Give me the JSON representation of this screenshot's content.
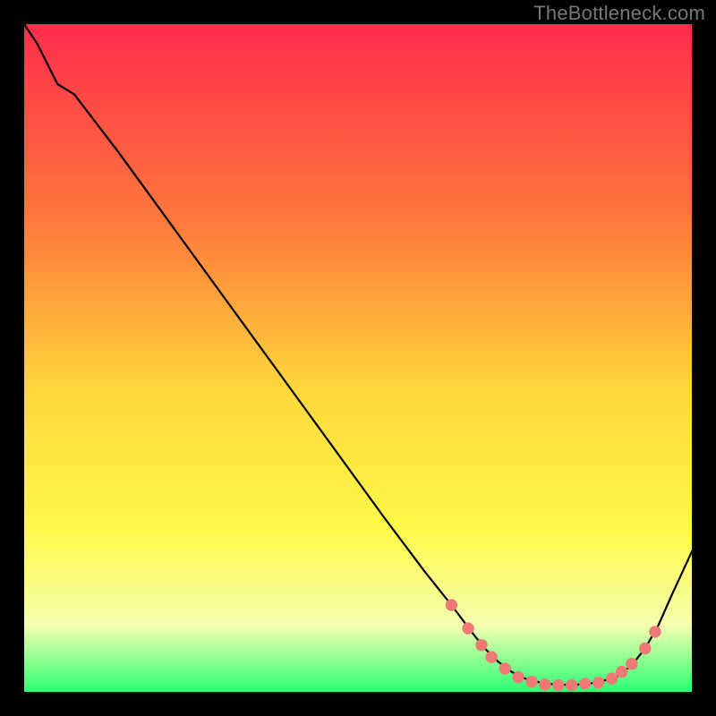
{
  "watermark": "TheBottleneck.com",
  "colors": {
    "bg": "#000000",
    "curve": "#000000",
    "dot": "#ef7a75",
    "grad_top": "#ff2c4c",
    "grad_mid1": "#ff7a3c",
    "grad_mid2": "#ffd83b",
    "grad_mid3": "#fff94a",
    "grad_mid4": "#f5ffb0",
    "grad_bottom": "#2dff73"
  },
  "chart_data": {
    "type": "line",
    "title": "",
    "xlabel": "",
    "ylabel": "",
    "xlim": [
      0,
      100
    ],
    "ylim": [
      0,
      100
    ],
    "note": "x/y are percentage-of-plot coordinates; y=0 at top, y=100 at bottom (as drawn).",
    "curve": [
      [
        0,
        0
      ],
      [
        2,
        3
      ],
      [
        5,
        9
      ],
      [
        7.5,
        10.5
      ],
      [
        14,
        19
      ],
      [
        22,
        30
      ],
      [
        30,
        41
      ],
      [
        38,
        52
      ],
      [
        46,
        63
      ],
      [
        54,
        74
      ],
      [
        60,
        82
      ],
      [
        64,
        87
      ],
      [
        67,
        91
      ],
      [
        69,
        93.5
      ],
      [
        71,
        95.5
      ],
      [
        73,
        97
      ],
      [
        75,
        98
      ],
      [
        78,
        98.8
      ],
      [
        82,
        99
      ],
      [
        86,
        98.6
      ],
      [
        89,
        97.6
      ],
      [
        91,
        96
      ],
      [
        93,
        93.5
      ],
      [
        95,
        90
      ],
      [
        97,
        85.5
      ],
      [
        100,
        79
      ]
    ],
    "dots": [
      [
        64,
        87
      ],
      [
        66.5,
        90.5
      ],
      [
        68.5,
        93
      ],
      [
        70,
        94.8
      ],
      [
        72,
        96.5
      ],
      [
        74,
        97.8
      ],
      [
        76,
        98.5
      ],
      [
        78,
        98.9
      ],
      [
        80,
        99
      ],
      [
        82,
        99
      ],
      [
        84,
        98.8
      ],
      [
        86,
        98.6
      ],
      [
        88,
        98
      ],
      [
        89.5,
        97
      ],
      [
        91,
        95.8
      ],
      [
        93,
        93.5
      ],
      [
        94.5,
        91
      ]
    ],
    "dot_radius_pct": 0.9
  }
}
